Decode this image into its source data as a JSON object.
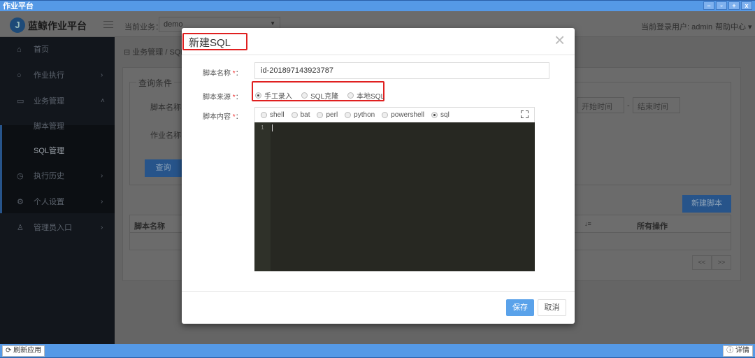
{
  "window": {
    "title": "作业平台",
    "controls": [
      "–",
      "▫",
      "+",
      "x"
    ]
  },
  "header": {
    "logo_letter": "J",
    "logo_text": "蓝鲸作业平台",
    "biz_label": "当前业务：",
    "biz_value": "demo",
    "user": "当前登录用户: admin",
    "help": "帮助中心 ▾"
  },
  "sidebar": {
    "items": [
      {
        "icon": "⌂",
        "label": "首页"
      },
      {
        "icon": "○",
        "label": "作业执行",
        "chev": "›"
      },
      {
        "icon": "▭",
        "label": "业务管理",
        "chev": "˄"
      },
      {
        "label": "脚本管理"
      },
      {
        "label": "SQL管理"
      },
      {
        "icon": "◷",
        "label": "执行历史",
        "chev": "›"
      },
      {
        "icon": "⚙",
        "label": "个人设置",
        "chev": "›"
      },
      {
        "icon": "♙",
        "label": "管理员入口",
        "chev": "›"
      }
    ]
  },
  "page": {
    "breadcrumb": "⊟ 业务管理  /  SQL",
    "query_legend": "查询条件",
    "script_name_label": "脚本名称：",
    "job_name_label": "作业名称：",
    "start_time": "开始时间",
    "dash": "-",
    "end_time": "结束时间",
    "query_btn": "查询",
    "new_script_btn": "新建脚本",
    "col_script_name": "脚本名称",
    "sort_icon": "↓≡",
    "col_actions": "所有操作",
    "prev": "<<",
    "next": ">>"
  },
  "modal": {
    "title": "新建SQL",
    "close": "×",
    "name_label": "脚本名称",
    "name_value": "id-201897143923787",
    "source_label": "脚本来源",
    "sources": [
      "手工录入",
      "SQL克隆",
      "本地SQL"
    ],
    "content_label": "脚本内容",
    "langs": [
      "shell",
      "bat",
      "perl",
      "python",
      "powershell",
      "sql"
    ],
    "line_no": "1",
    "req": "*",
    "colon": "：",
    "save": "保存",
    "cancel": "取消"
  },
  "bottom": {
    "refresh": "⟳ 刷新应用",
    "details": "ⓘ 详情"
  }
}
